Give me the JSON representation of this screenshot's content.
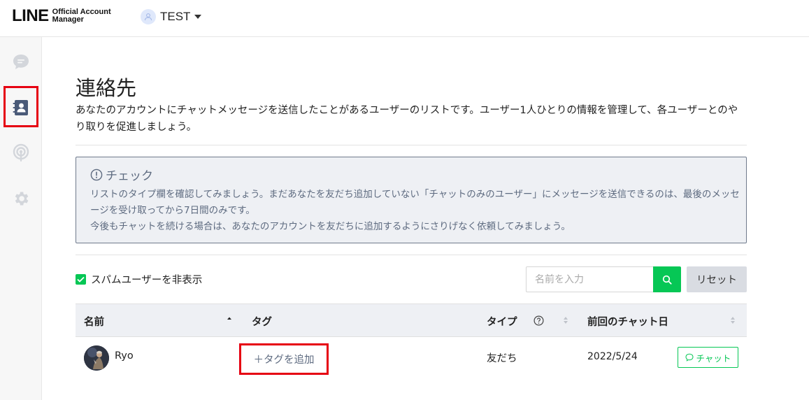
{
  "header": {
    "logo_main": "LINE",
    "logo_sub_1": "Official Account",
    "logo_sub_2": "Manager",
    "account_name": "TEST"
  },
  "sidebar": {
    "items": [
      {
        "icon": "chat-bubble-icon"
      },
      {
        "icon": "contacts-icon",
        "active": true
      },
      {
        "icon": "broadcast-icon"
      },
      {
        "icon": "gear-icon"
      }
    ]
  },
  "page": {
    "title": "連絡先",
    "description": "あなたのアカウントにチャットメッセージを送信したことがあるユーザーのリストです。ユーザー1人ひとりの情報を管理して、各ユーザーとのやり取りを促進しましょう。"
  },
  "notice": {
    "title": "チェック",
    "line1": "リストのタイプ欄を確認してみましょう。まだあなたを友だち追加していない「チャットのみのユーザー」にメッセージを送信できるのは、最後のメッセージを受け取ってから7日間のみです。",
    "line2": "今後もチャットを続ける場合は、あなたのアカウントを友だちに追加するようにさりげなく依頼してみましょう。"
  },
  "filters": {
    "spam_label": "スパムユーザーを非表示",
    "search_placeholder": "名前を入力",
    "reset_label": "リセット"
  },
  "table": {
    "columns": {
      "name": "名前",
      "tag": "タグ",
      "type": "タイプ",
      "last_chat": "前回のチャット日"
    },
    "rows": [
      {
        "name": "Ryo",
        "add_tag_label": "＋タグを追加",
        "type": "友だち",
        "last_chat": "2022/5/24",
        "chat_label": "チャット"
      }
    ]
  },
  "colors": {
    "accent_green": "#06c755",
    "highlight_red": "#e60012",
    "notice_text": "#5e6b80"
  }
}
